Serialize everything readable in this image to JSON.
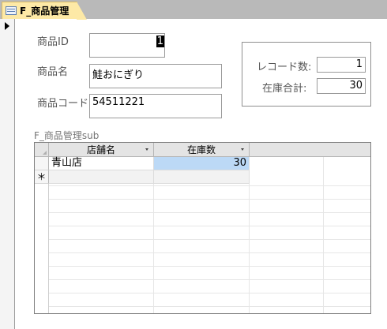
{
  "tab": {
    "title": "F_商品管理",
    "icon": "form-icon"
  },
  "form": {
    "product_id": {
      "label": "商品ID",
      "value": "1"
    },
    "product_name": {
      "label": "商品名",
      "value": "鮭おにぎり"
    },
    "product_code": {
      "label": "商品コード",
      "value": "54511221"
    }
  },
  "summary": {
    "record_count": {
      "label": "レコード数:",
      "value": "1"
    },
    "stock_total": {
      "label": "在庫合計:",
      "value": "30"
    }
  },
  "subform": {
    "caption": "F_商品管理sub",
    "columns": [
      "店舗名",
      "在庫数"
    ],
    "rows": [
      {
        "store": "青山店",
        "stock": "30"
      }
    ],
    "new_row_marker": "＊"
  }
}
